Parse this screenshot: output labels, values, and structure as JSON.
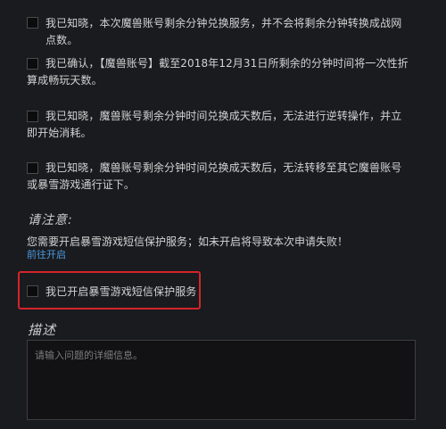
{
  "agreements": [
    {
      "text": "我已知晓，本次魔兽账号剩余分钟兑换服务，并不会将剩余分钟转换成战网点数。",
      "checked": false
    },
    {
      "text": "我已确认，【魔兽账号】截至2018年12月31日所剩余的分钟时间将一次性折算成畅玩天数。",
      "checked": false
    },
    {
      "text": "我已知晓，魔兽账号剩余分钟时间兑换成天数后，无法进行逆转操作，并立即开始消耗。",
      "checked": false
    },
    {
      "text": "我已知晓，魔兽账号剩余分钟时间兑换成天数后，无法转移至其它魔兽账号或暴雪游戏通行证下。",
      "checked": false
    }
  ],
  "notice": {
    "title": "请注意:",
    "message": "您需要开启暴雪游戏短信保护服务；如未开启将导致本次申请失败！",
    "link_label": "前往开启"
  },
  "sms_option": {
    "label": "我已开启暴雪游戏短信保护服务",
    "checked": false
  },
  "highlight_color": "#d3242a",
  "link_color": "#4b9be0",
  "description": {
    "title": "描述",
    "placeholder": "请输入问题的详细信息。",
    "value": ""
  }
}
